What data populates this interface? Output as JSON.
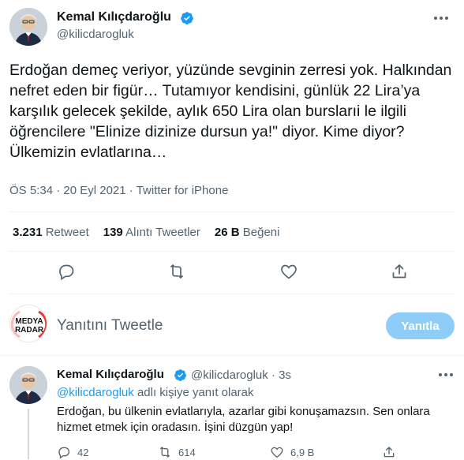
{
  "tweet": {
    "author_name": "Kemal Kılıçdaroğlu",
    "handle": "@kilicdarogluk",
    "text": "Erdoğan demeç veriyor, yüzünde sevginin zerresi yok. Halkından nefret eden bir figür… Tutamıyor kendisini, günlük 22 Lira’ya karşılık gelecek şekilde, aylık 650 Lira olan burslarıi le ilgili öğrencilere \"Elinize dizinize dursun ya!\" diyor. Kime diyor? Ülkemizin evlatlarına…",
    "time": "ÖS 5:34",
    "date": "20 Eyl 2021",
    "separator": "·",
    "source": "Twitter for iPhone",
    "stats": {
      "retweets_count": "3.231",
      "retweets_label": "Retweet",
      "quotes_count": "139",
      "quotes_label": "Alıntı Tweetler",
      "likes_count": "26 B",
      "likes_label": "Beğeni"
    },
    "action_icons": [
      "reply-icon",
      "retweet-icon",
      "like-icon",
      "share-icon"
    ]
  },
  "reply_composer": {
    "avatar_text_line1": "MEDYA",
    "avatar_text_line2": "RADAR",
    "placeholder": "Yanıtını Tweetle",
    "button_label": "Yanıtla"
  },
  "reply": {
    "author_name": "Kemal Kılıçdaroğlu",
    "handle": "@kilicdarogluk",
    "time_ago": "3s",
    "replying_to_mention": "@kilicdarogluk",
    "replying_to_suffix": "adlı kişiye yanıt olarak",
    "text": "Erdoğan, bu ülkenin evlatlarıyla, azarlar gibi konuşamazsın. Sen onlara hizmet etmek için oradasın. İşini düzgün yap!",
    "replies": "42",
    "retweets": "614",
    "likes": "6,9 B"
  },
  "colors": {
    "accent": "#1d9bf0",
    "muted": "#536471",
    "button_disabled": "#8ecdf8"
  }
}
